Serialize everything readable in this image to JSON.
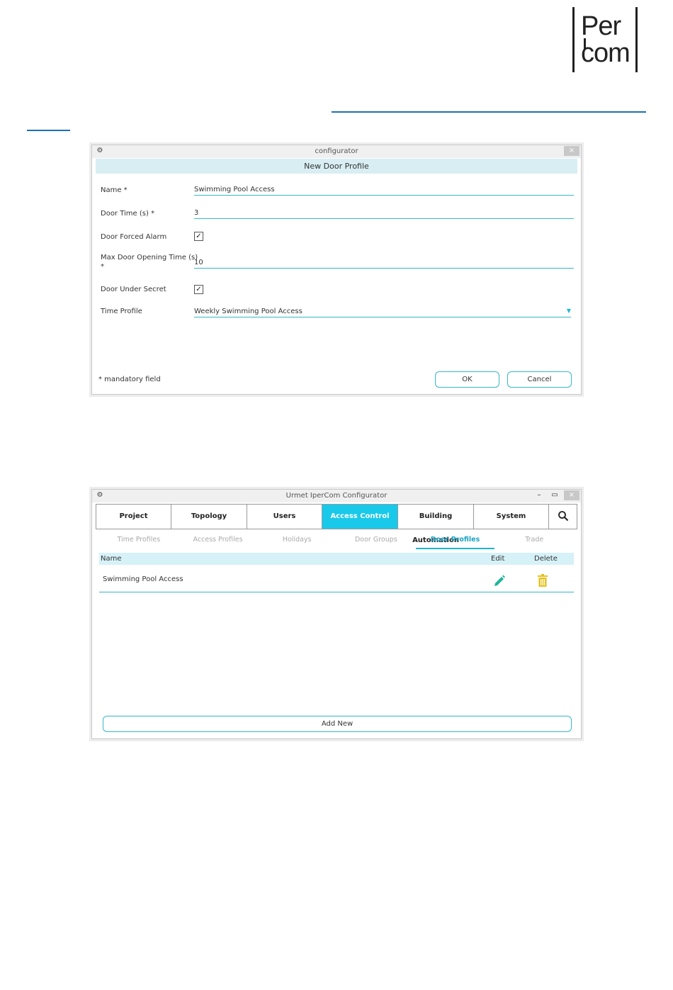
{
  "logo": {
    "line1": "Per",
    "line2": "com"
  },
  "dialog": {
    "window_title": "configurator",
    "header": "New Door Profile",
    "fields": {
      "name_label": "Name *",
      "name_value": "Swimming Pool Access",
      "door_time_label": "Door Time (s) *",
      "door_time_value": "3",
      "door_forced_label": "Door Forced Alarm",
      "max_door_label": "Max Door Opening Time (s)",
      "max_door_label_star": "*",
      "max_door_value": "10",
      "door_secret_label": "Door Under Secret",
      "time_profile_label": "Time Profile",
      "time_profile_value": "Weekly Swimming Pool Access"
    },
    "checkmark": "✓",
    "mandatory_note": "* mandatory field",
    "ok_label": "OK",
    "cancel_label": "Cancel",
    "close_glyph": "×"
  },
  "configurator": {
    "window_title": "Urmet IperCom Configurator",
    "nav": [
      "Project",
      "Topology",
      "Users",
      "Access Control",
      "Building Automation",
      "System"
    ],
    "subtabs": [
      "Time Profiles",
      "Access Profiles",
      "Holidays",
      "Door Groups",
      "Door Profiles",
      "Trade"
    ],
    "table": {
      "headers": {
        "name": "Name",
        "edit": "Edit",
        "delete": "Delete"
      },
      "rows": [
        {
          "name": "Swimming Pool Access"
        }
      ]
    },
    "add_new_label": "Add New",
    "min_glyph": "–",
    "max_glyph": "▭",
    "close_glyph": "×"
  },
  "colors": {
    "accent": "#19c9ea",
    "edit_icon": "#1fb59a",
    "delete_icon": "#e3c21e"
  }
}
